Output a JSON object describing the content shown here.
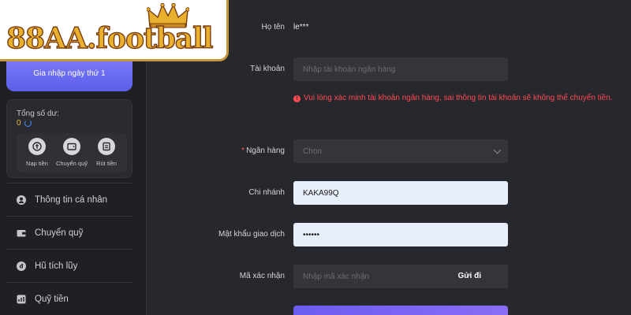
{
  "brand": {
    "logo_text": "88AA.football"
  },
  "sidebar": {
    "join_label": "Gia nhập ngày thứ 1",
    "balance_label": "Tổng số dư:",
    "balance_value": "0",
    "actions": [
      {
        "label": "Nạp tiền",
        "icon": "deposit-icon"
      },
      {
        "label": "Chuyển quỹ",
        "icon": "wallet-icon"
      },
      {
        "label": "Rút tiền",
        "icon": "withdraw-icon"
      }
    ],
    "menu": [
      {
        "label": "Thông tin cá nhân",
        "icon": "user-icon"
      },
      {
        "label": "Chuyển quỹ",
        "icon": "wallet-icon"
      },
      {
        "label": "Hũ tích lũy",
        "icon": "piggy-icon"
      },
      {
        "label": "Quỹ tiền",
        "icon": "fund-icon"
      }
    ]
  },
  "form": {
    "name_label": "Họ tên",
    "name_value": "le***",
    "account_label": "Tài khoản",
    "account_placeholder": "Nhập tài khoản ngân hàng",
    "warning": "Vui lòng xác minh tài khoản ngân hàng, sai thông tin tài khoản sẽ không thể chuyển tiền.",
    "bank_label": "Ngân hàng",
    "bank_placeholder": "Chọn",
    "branch_label": "Chi nhánh",
    "branch_value": "KAKA99Q",
    "password_label": "Mật khẩu giao dịch",
    "password_value": "••••••",
    "captcha_label": "Mã xác nhận",
    "captcha_placeholder": "Nhập mã xác nhận",
    "send_label": "Gửi đi"
  },
  "colors": {
    "accent": "#6b5cf0",
    "warning": "#ff4a52",
    "gold": "#e9b02e"
  }
}
